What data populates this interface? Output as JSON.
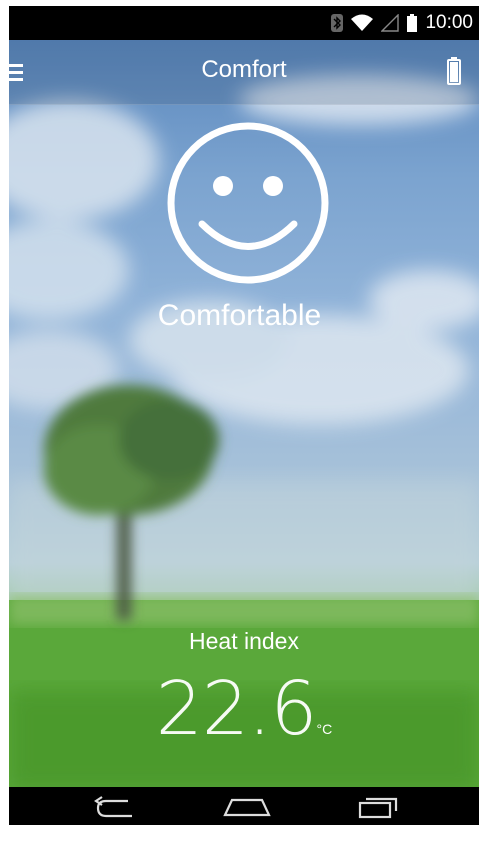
{
  "status_bar": {
    "time": "10:00",
    "icons": [
      "bluetooth-icon",
      "wifi-icon",
      "signal-icon",
      "battery-status-icon"
    ]
  },
  "app_bar": {
    "title": "Comfort",
    "menu_icon": "menu-icon",
    "battery_icon": "battery-icon"
  },
  "comfort": {
    "face_icon": "smiley-face-icon",
    "status": "Comfortable"
  },
  "heat_index": {
    "label": "Heat index",
    "value": "22.6",
    "unit": "°C"
  },
  "nav_bar": {
    "buttons": [
      "back-icon",
      "home-icon",
      "recent-apps-icon"
    ]
  },
  "colors": {
    "sky": "#7ba3cf",
    "grass": "#4f9d2f",
    "text": "#ffffff"
  }
}
